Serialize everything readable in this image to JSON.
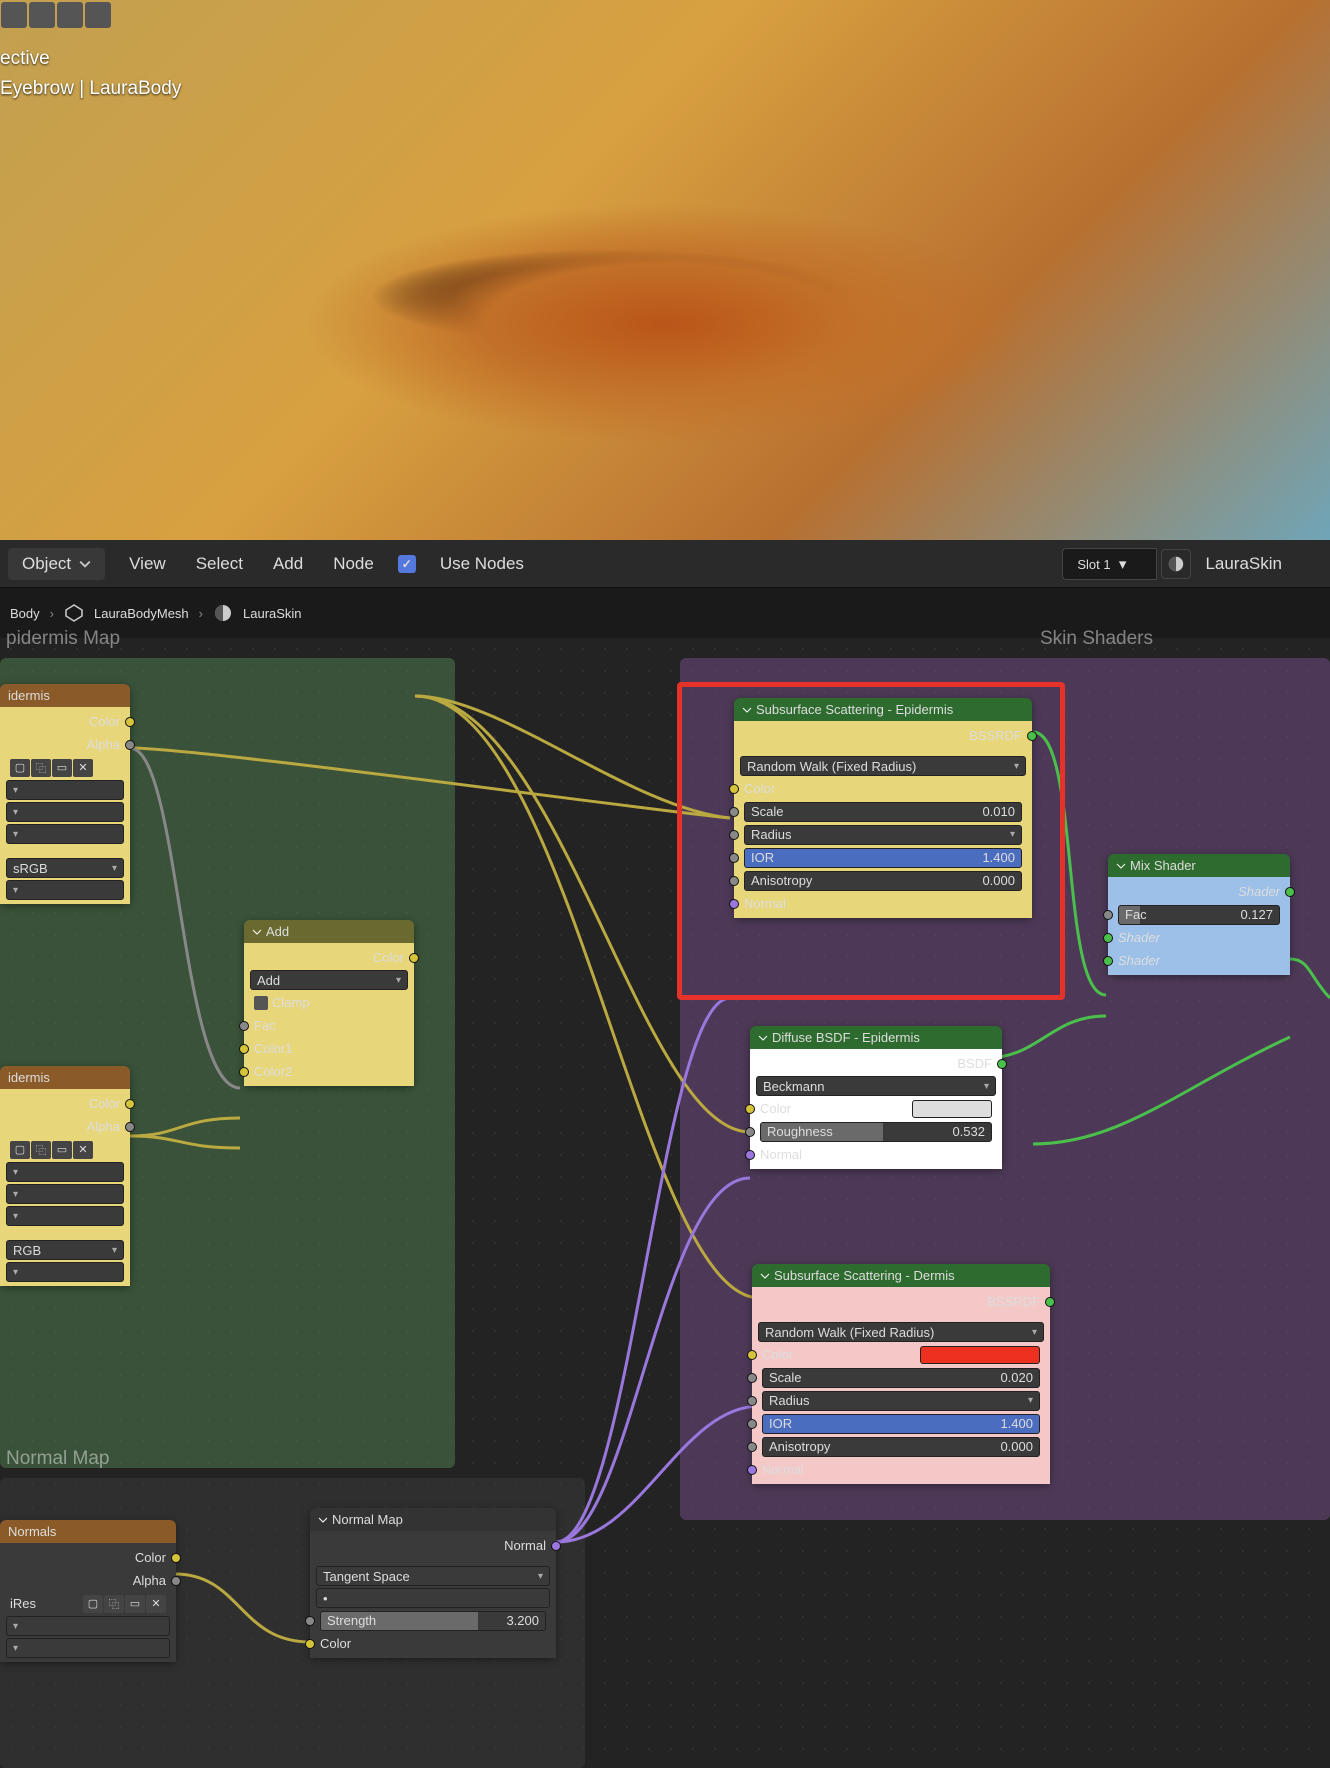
{
  "viewport": {
    "line1": "ective",
    "line2": "Eyebrow | LauraBody"
  },
  "menubar": {
    "mode": "Object",
    "items": [
      "View",
      "Select",
      "Add",
      "Node"
    ],
    "useNodesLabel": "Use Nodes",
    "slot": "Slot 1",
    "material": "LauraSkin"
  },
  "breadcrumb": {
    "items": [
      "Body",
      "LauraBodyMesh",
      "LauraSkin"
    ]
  },
  "frames": {
    "epidermis": "pidermis Map",
    "skin": "Skin Shaders",
    "normal": "Normal Map"
  },
  "imgNode1": {
    "title": "idermis",
    "out1": "Color",
    "out2": "Alpha",
    "cs": "sRGB"
  },
  "imgNode2": {
    "title": "idermis",
    "out1": "Color",
    "out2": "Alpha",
    "cs": "RGB"
  },
  "addNode": {
    "title": "Add",
    "out": "Color",
    "mode": "Add",
    "clamp": "Clamp",
    "in1": "Fac",
    "in2": "Color1",
    "in3": "Color2"
  },
  "sssEpi": {
    "title": "Subsurface Scattering - Epidermis",
    "out": "BSSRDF",
    "method": "Random Walk (Fixed Radius)",
    "color": "Color",
    "scale": "Scale",
    "scaleVal": "0.010",
    "radius": "Radius",
    "ior": "IOR",
    "iorVal": "1.400",
    "aniso": "Anisotropy",
    "anisoVal": "0.000",
    "normal": "Normal"
  },
  "diffuse": {
    "title": "Diffuse BSDF - Epidermis",
    "out": "BSDF",
    "method": "Beckmann",
    "color": "Color",
    "rough": "Roughness",
    "roughVal": "0.532",
    "normal": "Normal"
  },
  "sssDerm": {
    "title": "Subsurface Scattering - Dermis",
    "out": "BSSRDF",
    "method": "Random Walk (Fixed Radius)",
    "color": "Color",
    "scale": "Scale",
    "scaleVal": "0.020",
    "radius": "Radius",
    "ior": "IOR",
    "iorVal": "1.400",
    "aniso": "Anisotropy",
    "anisoVal": "0.000",
    "normal": "Normal"
  },
  "mix": {
    "title": "Mix Shader",
    "out": "Shader",
    "fac": "Fac",
    "facVal": "0.127",
    "in1": "Shader",
    "in2": "Shader"
  },
  "normalImg": {
    "title": "Normals",
    "out1": "Color",
    "out2": "Alpha",
    "ires": "iRes"
  },
  "normalMap": {
    "title": "Normal Map",
    "out": "Normal",
    "space": "Tangent Space",
    "strength": "Strength",
    "strengthVal": "3.200",
    "color": "Color"
  }
}
